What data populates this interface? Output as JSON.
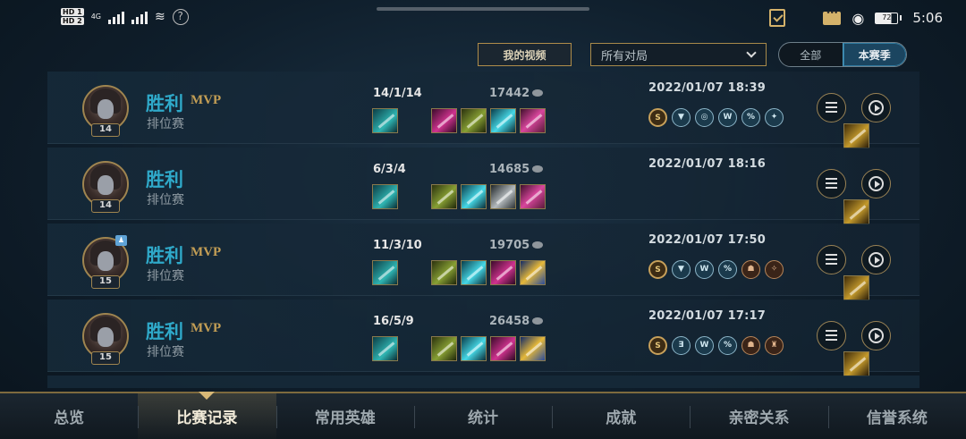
{
  "status_bar": {
    "hd1": "HD 1",
    "hd2": "HD 2",
    "network": "4G",
    "help_icon": "question-mark-icon",
    "battery": "72",
    "time": "5:06"
  },
  "filters": {
    "my_video_label": "我的视频",
    "match_type_value": "所有对局",
    "season_all_label": "全部",
    "season_current_label": "本赛季"
  },
  "matches": [
    {
      "result": "胜利",
      "mvp": "MVP",
      "mode": "排位赛",
      "level": "14",
      "kda": "14/1/14",
      "gold": "17442",
      "datetime": "2022/01/07 18:39",
      "party": false,
      "items": [
        "teal",
        "gold",
        "magenta",
        "olive",
        "cyan",
        "pink"
      ],
      "badges": [
        {
          "glyph": "S",
          "kind": "s"
        },
        {
          "glyph": "▼",
          "kind": "blue"
        },
        {
          "glyph": "◎",
          "kind": "blue"
        },
        {
          "glyph": "W",
          "kind": "blue"
        },
        {
          "glyph": "%",
          "kind": "blue"
        },
        {
          "glyph": "✦",
          "kind": "blue"
        }
      ]
    },
    {
      "result": "胜利",
      "mvp": "",
      "mode": "排位赛",
      "level": "14",
      "kda": "6/3/4",
      "gold": "14685",
      "datetime": "2022/01/07 18:16",
      "party": false,
      "items": [
        "teal",
        "gold",
        "olive",
        "cyan",
        "steel",
        "pink"
      ],
      "badges": []
    },
    {
      "result": "胜利",
      "mvp": "MVP",
      "mode": "排位赛",
      "level": "15",
      "kda": "11/3/10",
      "gold": "19705",
      "datetime": "2022/01/07 17:50",
      "party": true,
      "items": [
        "teal",
        "gold",
        "olive",
        "cyan",
        "magenta",
        "blue"
      ],
      "badges": [
        {
          "glyph": "S",
          "kind": "s"
        },
        {
          "glyph": "▼",
          "kind": "blue"
        },
        {
          "glyph": "W",
          "kind": "blue"
        },
        {
          "glyph": "%",
          "kind": "blue"
        },
        {
          "glyph": "☗",
          "kind": "bronze"
        },
        {
          "glyph": "✧",
          "kind": "bronze"
        }
      ]
    },
    {
      "result": "胜利",
      "mvp": "MVP",
      "mode": "排位赛",
      "level": "15",
      "kda": "16/5/9",
      "gold": "26458",
      "datetime": "2022/01/07 17:17",
      "party": false,
      "items": [
        "teal",
        "gold",
        "olive",
        "cyan",
        "magenta",
        "blue"
      ],
      "badges": [
        {
          "glyph": "S",
          "kind": "s"
        },
        {
          "glyph": "Ǝ",
          "kind": "blue"
        },
        {
          "glyph": "W",
          "kind": "blue"
        },
        {
          "glyph": "%",
          "kind": "blue"
        },
        {
          "glyph": "☗",
          "kind": "bronze"
        },
        {
          "glyph": "♜",
          "kind": "bronze"
        }
      ]
    }
  ],
  "nav": {
    "active_index": 1,
    "tabs": [
      "总览",
      "比赛记录",
      "常用英雄",
      "统计",
      "成就",
      "亲密关系",
      "信誉系统"
    ]
  },
  "icons": {
    "detail": "list-icon",
    "replay": "play-circle-icon",
    "gold": "gold-coin-icon",
    "dropdown": "chevron-down-icon"
  },
  "colors": {
    "accent_gold": "#b08d4a",
    "victory_blue": "#2fa9c9",
    "mvp_gold": "#c39e55"
  }
}
